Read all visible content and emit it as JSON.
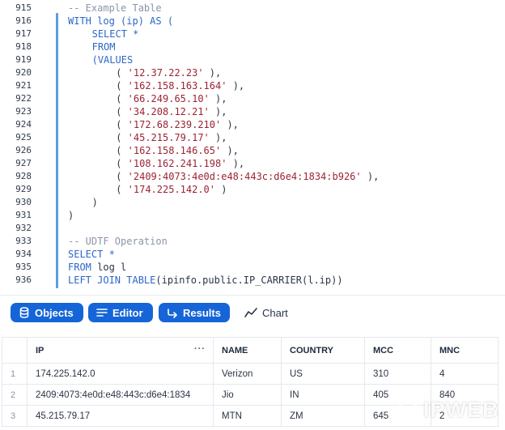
{
  "editor": {
    "lines": [
      {
        "no": "915",
        "indent": 0,
        "parts": [
          {
            "t": "-- Example Table",
            "c": "cm"
          }
        ]
      },
      {
        "no": "916",
        "indent": 0,
        "parts": [
          {
            "t": "WITH",
            "c": "kw"
          },
          {
            "t": " log (ip) ",
            "c": "kw"
          },
          {
            "t": "AS (",
            "c": "kw"
          }
        ]
      },
      {
        "no": "917",
        "indent": 4,
        "parts": [
          {
            "t": "SELECT *",
            "c": "kw"
          }
        ]
      },
      {
        "no": "918",
        "indent": 4,
        "parts": [
          {
            "t": "FROM",
            "c": "kw"
          }
        ]
      },
      {
        "no": "919",
        "indent": 4,
        "parts": [
          {
            "t": "(VALUES",
            "c": "kw"
          }
        ]
      },
      {
        "no": "920",
        "indent": 8,
        "parts": [
          {
            "t": "( ",
            "c": "plain"
          },
          {
            "t": "'12.37.22.23'",
            "c": "str"
          },
          {
            "t": " ),",
            "c": "plain"
          }
        ]
      },
      {
        "no": "921",
        "indent": 8,
        "parts": [
          {
            "t": "( ",
            "c": "plain"
          },
          {
            "t": "'162.158.163.164'",
            "c": "str"
          },
          {
            "t": " ),",
            "c": "plain"
          }
        ]
      },
      {
        "no": "922",
        "indent": 8,
        "parts": [
          {
            "t": "( ",
            "c": "plain"
          },
          {
            "t": "'66.249.65.10'",
            "c": "str"
          },
          {
            "t": " ),",
            "c": "plain"
          }
        ]
      },
      {
        "no": "923",
        "indent": 8,
        "parts": [
          {
            "t": "( ",
            "c": "plain"
          },
          {
            "t": "'34.208.12.21'",
            "c": "str"
          },
          {
            "t": " ),",
            "c": "plain"
          }
        ]
      },
      {
        "no": "924",
        "indent": 8,
        "parts": [
          {
            "t": "( ",
            "c": "plain"
          },
          {
            "t": "'172.68.239.210'",
            "c": "str"
          },
          {
            "t": " ),",
            "c": "plain"
          }
        ]
      },
      {
        "no": "925",
        "indent": 8,
        "parts": [
          {
            "t": "( ",
            "c": "plain"
          },
          {
            "t": "'45.215.79.17'",
            "c": "str"
          },
          {
            "t": " ),",
            "c": "plain"
          }
        ]
      },
      {
        "no": "926",
        "indent": 8,
        "parts": [
          {
            "t": "( ",
            "c": "plain"
          },
          {
            "t": "'162.158.146.65'",
            "c": "str"
          },
          {
            "t": " ),",
            "c": "plain"
          }
        ]
      },
      {
        "no": "927",
        "indent": 8,
        "parts": [
          {
            "t": "( ",
            "c": "plain"
          },
          {
            "t": "'108.162.241.198'",
            "c": "str"
          },
          {
            "t": " ),",
            "c": "plain"
          }
        ]
      },
      {
        "no": "928",
        "indent": 8,
        "parts": [
          {
            "t": "( ",
            "c": "plain"
          },
          {
            "t": "'2409:4073:4e0d:e48:443c:d6e4:1834:b926'",
            "c": "str"
          },
          {
            "t": " ),",
            "c": "plain"
          }
        ]
      },
      {
        "no": "929",
        "indent": 8,
        "parts": [
          {
            "t": "( ",
            "c": "plain"
          },
          {
            "t": "'174.225.142.0'",
            "c": "str"
          },
          {
            "t": " )",
            "c": "plain"
          }
        ]
      },
      {
        "no": "930",
        "indent": 4,
        "parts": [
          {
            "t": ")",
            "c": "plain"
          }
        ]
      },
      {
        "no": "931",
        "indent": 0,
        "parts": [
          {
            "t": ")",
            "c": "plain"
          }
        ]
      },
      {
        "no": "932",
        "indent": 0,
        "parts": []
      },
      {
        "no": "933",
        "indent": 0,
        "parts": [
          {
            "t": "-- UDTF Operation",
            "c": "cm"
          }
        ]
      },
      {
        "no": "934",
        "indent": 0,
        "parts": [
          {
            "t": "SELECT *",
            "c": "kw"
          }
        ]
      },
      {
        "no": "935",
        "indent": 0,
        "parts": [
          {
            "t": "FROM",
            "c": "kw"
          },
          {
            "t": " log l",
            "c": "plain"
          }
        ]
      },
      {
        "no": "936",
        "indent": 0,
        "parts": [
          {
            "t": "LEFT JOIN TABLE",
            "c": "kw"
          },
          {
            "t": "(ipinfo.public.IP_CARRIER(l.ip))",
            "c": "plain"
          }
        ]
      }
    ]
  },
  "toolbar": {
    "objects_label": "Objects",
    "editor_label": "Editor",
    "results_label": "Results",
    "chart_label": "Chart"
  },
  "results": {
    "columns": [
      "IP",
      "NAME",
      "COUNTRY",
      "MCC",
      "MNC"
    ],
    "ip_menu": "···",
    "rows": [
      {
        "idx": "1",
        "ip": "174.225.142.0",
        "name": "Verizon",
        "country": "US",
        "mcc": "310",
        "mnc": "4"
      },
      {
        "idx": "2",
        "ip": "2409:4073:4e0d:e48:443c:d6e4:1834",
        "name": "Jio",
        "country": "IN",
        "mcc": "405",
        "mnc": "840"
      },
      {
        "idx": "3",
        "ip": "45.215.79.17",
        "name": "MTN",
        "country": "ZM",
        "mcc": "645",
        "mnc": "2"
      }
    ]
  },
  "watermark": {
    "text": "IPWEB"
  },
  "colors": {
    "accent": "#1565d8",
    "keyword": "#2d67c8",
    "string": "#9c2333",
    "comment": "#8a96a8"
  }
}
